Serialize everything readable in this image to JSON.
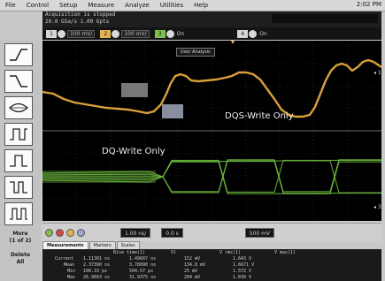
{
  "menu": {
    "items": [
      "File",
      "Control",
      "Setup",
      "Measure",
      "Analyze",
      "Utilities",
      "Help"
    ],
    "clock": "2:02 PM"
  },
  "status": {
    "line1": "Acquisition is stopped",
    "line2": "20.0 GSa/s  1.00 Gpts"
  },
  "channels": {
    "ch1_scale": "100 mV/",
    "ch2_scale": "100 mV/",
    "on_label": "On",
    "on_label_2": "On"
  },
  "screen": {
    "user_tag": "User Analysis",
    "dqs_label": "DQS-Write Only",
    "dq_label": "DQ-Write Only"
  },
  "sidebar": {
    "more_label": "More",
    "more_sub": "(1 of 2)",
    "delete_label": "Delete",
    "delete_sub": "All"
  },
  "controls": {
    "timebase": "1.00 ns/",
    "delay": "0.0 s",
    "trigger_level": "500 mV"
  },
  "tabs": [
    "Measurements",
    "Markers",
    "Scales"
  ],
  "measurements": {
    "headers": [
      "",
      "Rise time(1)",
      "Sl",
      "V rms(1)",
      "V max(1)"
    ],
    "rows": [
      [
        "Current",
        "1.11301 ns",
        "1.49607 ns",
        "152 mV",
        "1.643 V"
      ],
      [
        "Mean",
        "2.37390 ns",
        "3.78090 ns",
        "134.8 mV",
        "1.6671 V"
      ],
      [
        "Min",
        "100.33 ps",
        "504.57 ps",
        "25 mV",
        "1.572 V"
      ],
      [
        "Max",
        "26.9843 ns",
        "31.9375 ns",
        "204 mV",
        "1.699 V"
      ]
    ]
  },
  "colors": {
    "dqs_trace": "#d9a03a",
    "dq_trace": "#6fbf3f",
    "screen_bg": "#000000",
    "accent_yellow": "#e0b452"
  }
}
